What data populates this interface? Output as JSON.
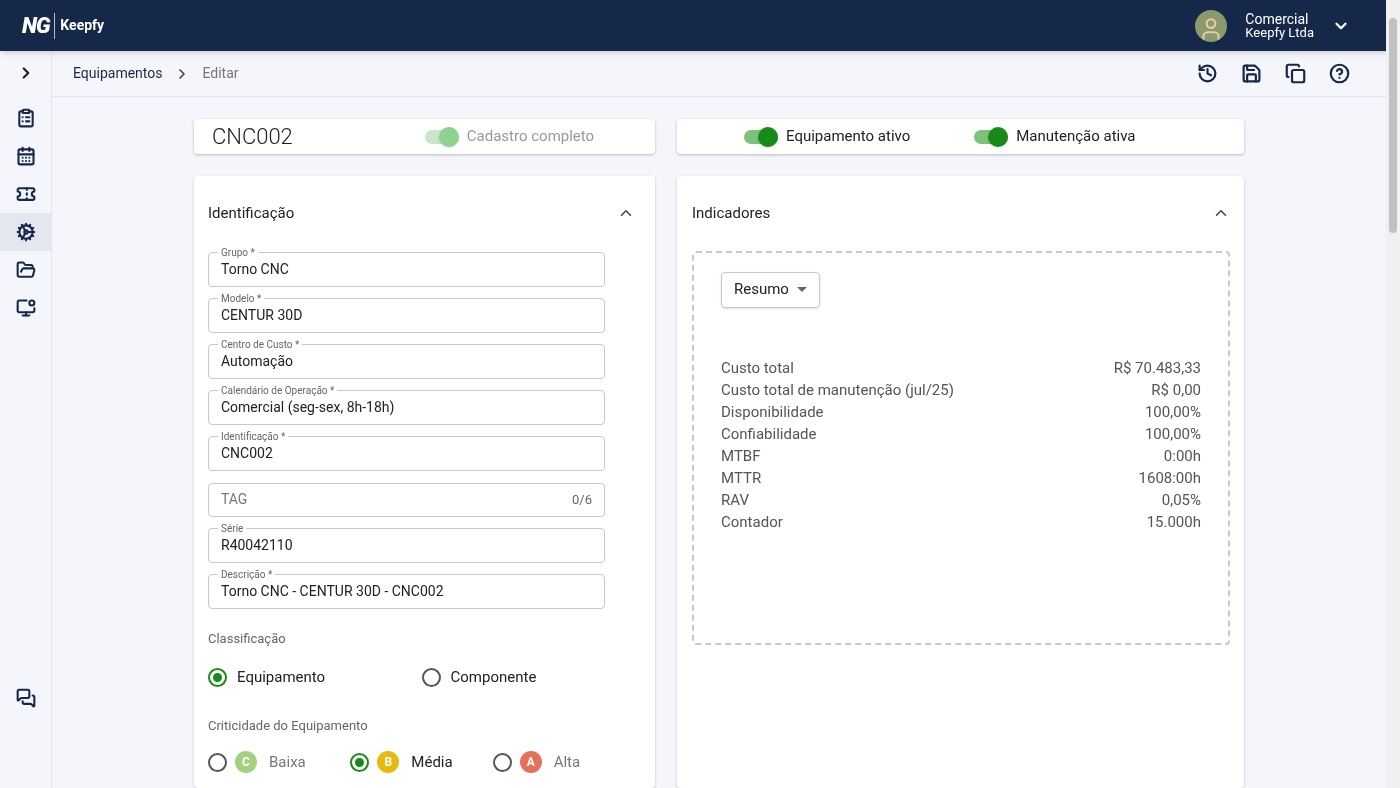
{
  "header": {
    "logo": "NG",
    "brand": "Keepfy",
    "user": {
      "name": "Comercial",
      "company": "Keepfy Ltda"
    }
  },
  "sidebar": {
    "items": [
      {
        "selected": false
      },
      {
        "selected": false
      },
      {
        "selected": false
      },
      {
        "selected": true
      },
      {
        "selected": false
      },
      {
        "selected": false
      }
    ]
  },
  "breadcrumb": [
    "Equipamentos",
    "Editar"
  ],
  "title_card": {
    "code": "CNC002",
    "toggle": {
      "label": "Cadastro completo",
      "on": true,
      "disabled": true
    }
  },
  "status_toggles": [
    {
      "label": "Equipamento ativo",
      "on": true
    },
    {
      "label": "Manutenção ativa",
      "on": true
    }
  ],
  "identificacao": {
    "title": "Identificação",
    "expanded": true,
    "fields": [
      {
        "label": "Grupo *",
        "value": "Torno CNC"
      },
      {
        "label": "Modelo *",
        "value": "CENTUR 30D"
      },
      {
        "label": "Centro de Custo *",
        "value": "Automação"
      },
      {
        "label": "Calendário de Operação *",
        "value": "Comercial (seg-sex, 8h-18h)"
      },
      {
        "label": "Identificação *",
        "value": "CNC002"
      },
      {
        "placeholder": "TAG",
        "counter": "0/6"
      },
      {
        "label": "Série",
        "value": "R40042110"
      },
      {
        "label": "Descrição *",
        "value": "Torno CNC - CENTUR 30D - CNC002"
      }
    ],
    "classificacao": {
      "label": "Classificação",
      "options": [
        {
          "label": "Equipamento",
          "selected": true
        },
        {
          "label": "Componente",
          "selected": false
        }
      ]
    },
    "criticidade": {
      "label": "Criticidade do Equipamento",
      "options": [
        {
          "badge": "C",
          "label": "Baixa",
          "color": "#a5d17f",
          "selected": false
        },
        {
          "badge": "B",
          "label": "Média",
          "color": "#e8b90f",
          "selected": true
        },
        {
          "badge": "A",
          "label": "Alta",
          "color": "#e5715a",
          "selected": false
        }
      ]
    }
  },
  "indicadores": {
    "title": "Indicadores",
    "expanded": true,
    "dropdown": "Resumo",
    "rows": [
      {
        "label": "Custo total",
        "value": "R$ 70.483,33"
      },
      {
        "label": "Custo total de manutenção (jul/25)",
        "value": "R$ 0,00"
      },
      {
        "label": "Disponibilidade",
        "value": "100,00%"
      },
      {
        "label": "Confiabilidade",
        "value": "100,00%"
      },
      {
        "label": "MTBF",
        "value": "0:00h"
      },
      {
        "label": "MTTR",
        "value": "1608:00h"
      },
      {
        "label": "RAV",
        "value": "0,05%"
      },
      {
        "label": "Contador",
        "value": "15.000h"
      }
    ]
  }
}
